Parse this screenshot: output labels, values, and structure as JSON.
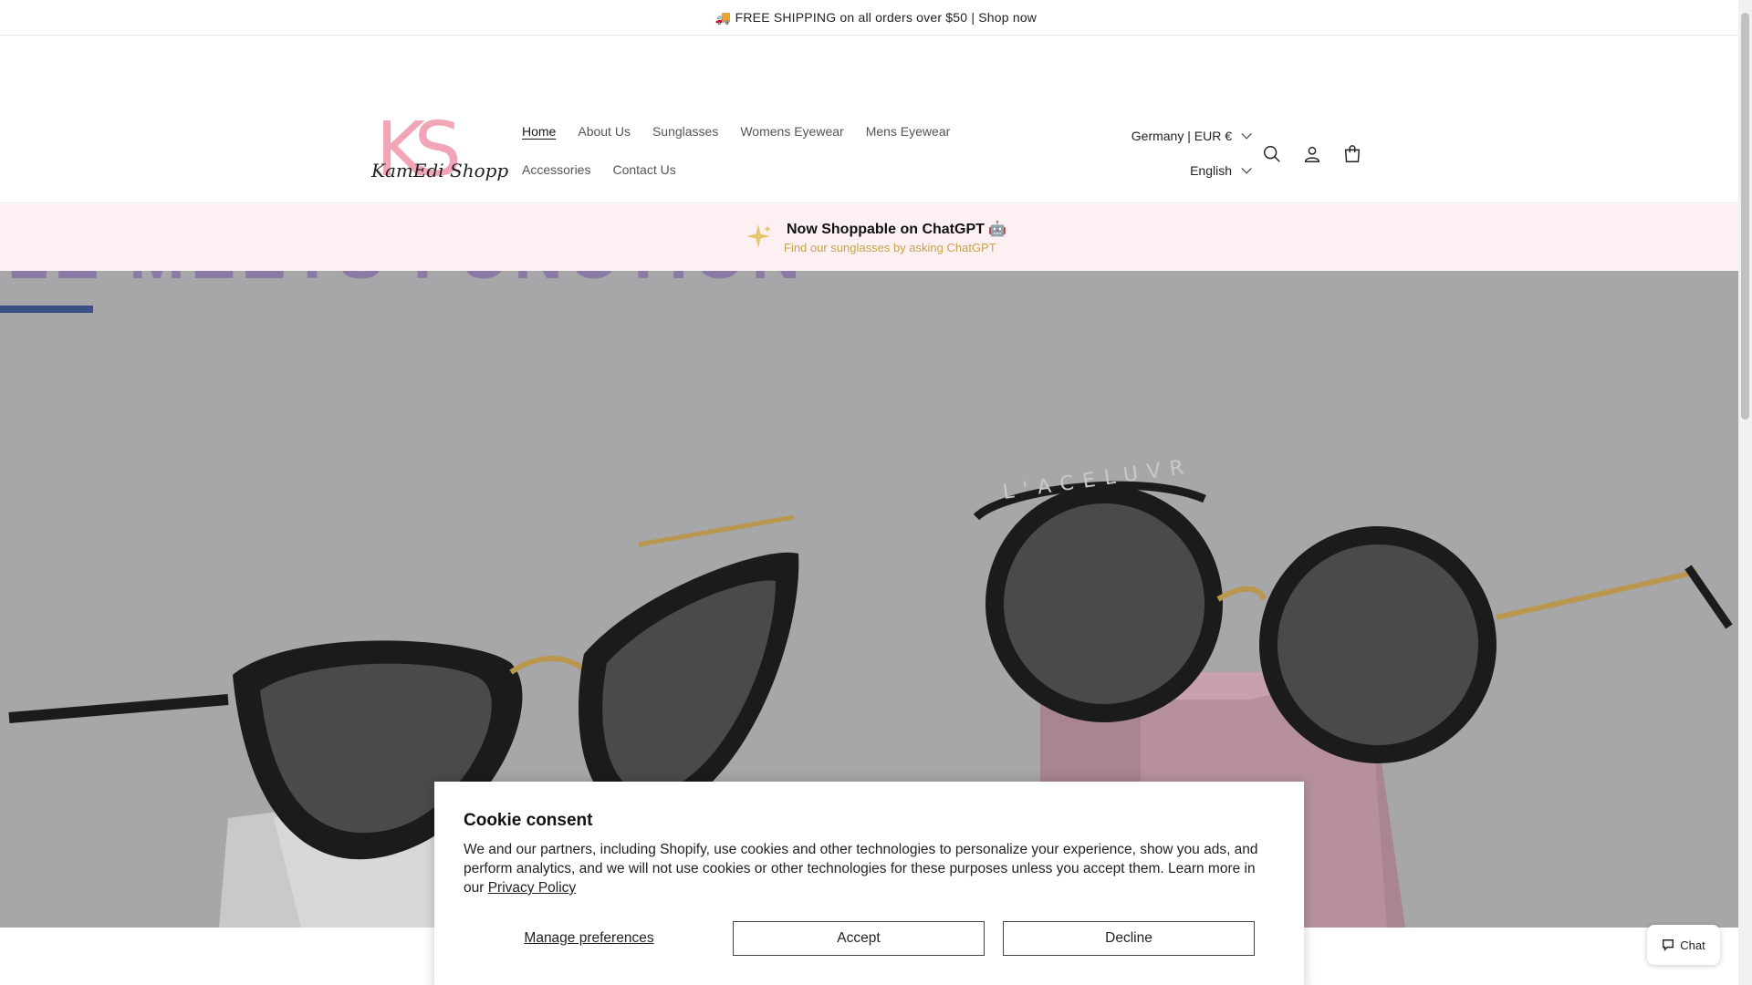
{
  "announcement": {
    "text": "🚚 FREE SHIPPING on all orders over $50 | Shop now"
  },
  "logo": {
    "monogram": "KS",
    "script": "KamEdi Shopp"
  },
  "nav": {
    "items": [
      {
        "label": "Home",
        "active": true
      },
      {
        "label": "About Us"
      },
      {
        "label": "Sunglasses"
      },
      {
        "label": "Womens Eyewear"
      },
      {
        "label": "Mens Eyewear"
      },
      {
        "label": "Accessories"
      },
      {
        "label": "Contact Us"
      }
    ]
  },
  "locale": {
    "country": "Germany | EUR €",
    "language": "English"
  },
  "header_icons": [
    "search-icon",
    "account-icon",
    "cart-icon"
  ],
  "promo": {
    "title": "Now Shoppable on ChatGPT 🤖",
    "subtitle": "Find our sunglasses by asking ChatGPT"
  },
  "hero": {
    "headline": "LE MEETS FUNCTION",
    "frame_text": "L'ACELUVR"
  },
  "cookie": {
    "title": "Cookie consent",
    "body": "We and our partners, including Shopify, use cookies and other technologies to personalize your experience, show you ads, and perform analytics, and we will not use cookies or other technologies for these purposes unless you accept them. Learn more in our ",
    "privacy_link": "Privacy Policy",
    "manage": "Manage preferences",
    "accept": "Accept",
    "decline": "Decline"
  },
  "chat": {
    "label": "Chat"
  },
  "colors": {
    "promo_bg": "#fdf0f3",
    "promo_sub": "#c9a24a",
    "logo_pink": "#f2a5b7"
  }
}
